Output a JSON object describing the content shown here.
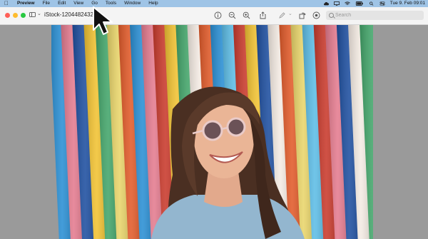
{
  "menubar": {
    "apple_icon": "apple-icon",
    "items": [
      "Preview",
      "File",
      "Edit",
      "View",
      "Go",
      "Tools",
      "Window",
      "Help"
    ],
    "status_icons": [
      "cloud-icon",
      "display-icon",
      "wifi-icon",
      "battery-icon",
      "search-icon",
      "control-center-icon"
    ],
    "clock": "Tue 9. Feb 09:01"
  },
  "window": {
    "filename": "iStock-1204482432.jpg",
    "toolbar_icons": [
      "info-icon",
      "zoom-out-icon",
      "zoom-in-icon",
      "share-icon",
      "markup-icon",
      "rotate-icon",
      "annotate-icon"
    ],
    "search": {
      "placeholder": "Search",
      "value": ""
    }
  },
  "photo": {
    "subject": "woman-laughing-sunglasses",
    "stripe_colors": [
      "#2a8fd4",
      "#f1c232",
      "#e25b2a",
      "#c93a2c",
      "#f4ebe3",
      "#5dbde6",
      "#1e4fa0",
      "#e9d56a",
      "#e47b8f",
      "#43a56a"
    ]
  },
  "colors": {
    "menubar_bg": "#9fc4e6",
    "toolbar_bg": "#f4f4f4",
    "canvas_bg": "#9a9a9a"
  }
}
